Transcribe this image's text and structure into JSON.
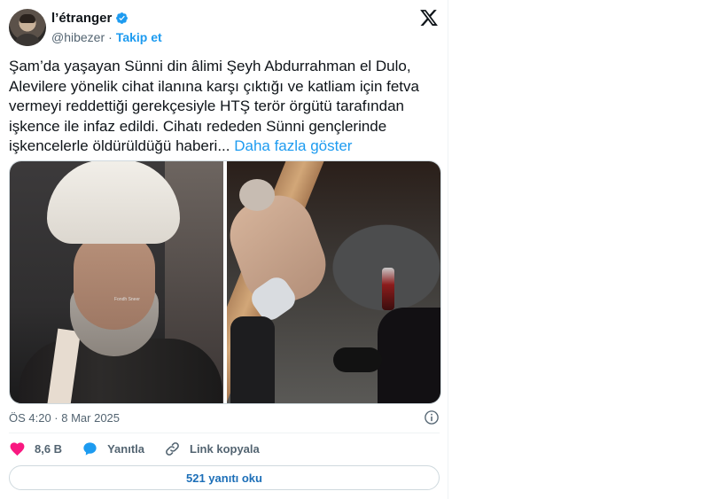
{
  "author": {
    "display_name": "l’étranger",
    "handle": "@hibezer",
    "separator": "·",
    "follow_label": "Takip et",
    "avatar_icon": "user-avatar-icon",
    "verified_icon": "verified-badge-icon"
  },
  "tweet": {
    "text": "Şam’da yaşayan Sünni din âlimi Şeyh Abdurrahman el Dulo,\nAlevilere yönelik cihat ilanına karşı çıktığı ve katliam için fetva\nvermeyi reddettiği gerekçesiyle HTŞ terör örgütü tarafından\nişkence ile infaz edildi. Cihatı rededen Sünni gençlerinde\nişkencelerle öldürüldüğü haberi... ",
    "show_more_label": "Daha fazla göster",
    "timestamp": "ÖS 4:20 · 8 Mar 2025"
  },
  "media": {
    "photo_left_watermark": "Fondh Sneer"
  },
  "actions": {
    "likes": "8,6 B",
    "reply_label": "Yanıtla",
    "copy_link_label": "Link kopyala"
  },
  "read_replies_label": "521 yanıtı oku",
  "colors": {
    "accent": "#1d9bf0",
    "like": "#f91880",
    "text": "#0f1419",
    "muted": "#536471"
  }
}
